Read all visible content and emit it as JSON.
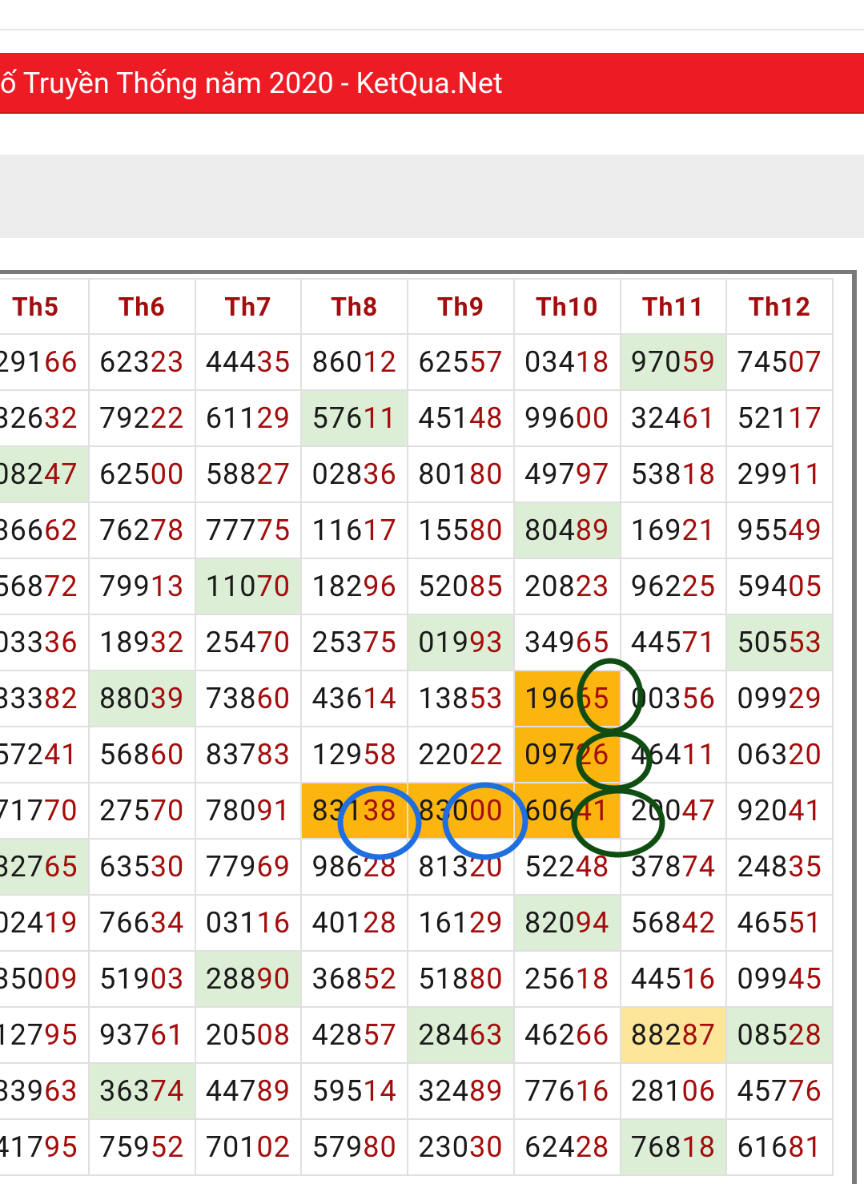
{
  "page": {
    "title": "ố Truyền Thống năm 2020 - KetQua.Net"
  },
  "table": {
    "headers": [
      "Th5",
      "Th6",
      "Th7",
      "Th8",
      "Th9",
      "Th10",
      "Th11",
      "Th12"
    ],
    "rows": [
      [
        {
          "h": "291",
          "t": "66"
        },
        {
          "h": "623",
          "t": "23"
        },
        {
          "h": "444",
          "t": "35"
        },
        {
          "h": "860",
          "t": "12"
        },
        {
          "h": "625",
          "t": "57"
        },
        {
          "h": "034",
          "t": "18"
        },
        {
          "h": "970",
          "t": "59",
          "hl": "green"
        },
        {
          "h": "745",
          "t": "07"
        }
      ],
      [
        {
          "h": "326",
          "t": "32"
        },
        {
          "h": "792",
          "t": "22"
        },
        {
          "h": "611",
          "t": "29"
        },
        {
          "h": "576",
          "t": "11",
          "hl": "green"
        },
        {
          "h": "451",
          "t": "48"
        },
        {
          "h": "996",
          "t": "00"
        },
        {
          "h": "324",
          "t": "61"
        },
        {
          "h": "521",
          "t": "17"
        }
      ],
      [
        {
          "h": "082",
          "t": "47",
          "hl": "green"
        },
        {
          "h": "625",
          "t": "00"
        },
        {
          "h": "588",
          "t": "27"
        },
        {
          "h": "028",
          "t": "36"
        },
        {
          "h": "801",
          "t": "80"
        },
        {
          "h": "497",
          "t": "97"
        },
        {
          "h": "538",
          "t": "18"
        },
        {
          "h": "299",
          "t": "11"
        }
      ],
      [
        {
          "h": "366",
          "t": "62"
        },
        {
          "h": "762",
          "t": "78"
        },
        {
          "h": "777",
          "t": "75"
        },
        {
          "h": "116",
          "t": "17"
        },
        {
          "h": "155",
          "t": "80"
        },
        {
          "h": "804",
          "t": "89",
          "hl": "green"
        },
        {
          "h": "169",
          "t": "21"
        },
        {
          "h": "955",
          "t": "49"
        }
      ],
      [
        {
          "h": "568",
          "t": "72"
        },
        {
          "h": "799",
          "t": "13"
        },
        {
          "h": "110",
          "t": "70",
          "hl": "green"
        },
        {
          "h": "182",
          "t": "96"
        },
        {
          "h": "520",
          "t": "85"
        },
        {
          "h": "208",
          "t": "23"
        },
        {
          "h": "962",
          "t": "25"
        },
        {
          "h": "594",
          "t": "05"
        }
      ],
      [
        {
          "h": "033",
          "t": "36"
        },
        {
          "h": "189",
          "t": "32"
        },
        {
          "h": "254",
          "t": "70"
        },
        {
          "h": "253",
          "t": "75"
        },
        {
          "h": "019",
          "t": "93",
          "hl": "green"
        },
        {
          "h": "349",
          "t": "65"
        },
        {
          "h": "445",
          "t": "71"
        },
        {
          "h": "505",
          "t": "53",
          "hl": "green"
        }
      ],
      [
        {
          "h": "333",
          "t": "82"
        },
        {
          "h": "880",
          "t": "39",
          "hl": "green"
        },
        {
          "h": "738",
          "t": "60"
        },
        {
          "h": "436",
          "t": "14"
        },
        {
          "h": "138",
          "t": "53"
        },
        {
          "h": "196",
          "t": "65",
          "hl": "orange"
        },
        {
          "h": "003",
          "t": "56"
        },
        {
          "h": "099",
          "t": "29"
        }
      ],
      [
        {
          "h": "572",
          "t": "41"
        },
        {
          "h": "568",
          "t": "60"
        },
        {
          "h": "837",
          "t": "83"
        },
        {
          "h": "129",
          "t": "58"
        },
        {
          "h": "220",
          "t": "22"
        },
        {
          "h": "097",
          "t": "26",
          "hl": "orange"
        },
        {
          "h": "464",
          "t": "11"
        },
        {
          "h": "063",
          "t": "20"
        }
      ],
      [
        {
          "h": "717",
          "t": "70"
        },
        {
          "h": "275",
          "t": "70"
        },
        {
          "h": "780",
          "t": "91"
        },
        {
          "h": "831",
          "t": "38",
          "hl": "orange"
        },
        {
          "h": "830",
          "t": "00",
          "hl": "orange"
        },
        {
          "h": "606",
          "t": "41",
          "hl": "orange"
        },
        {
          "h": "200",
          "t": "47"
        },
        {
          "h": "920",
          "t": "41"
        }
      ],
      [
        {
          "h": "327",
          "t": "65",
          "hl": "green"
        },
        {
          "h": "635",
          "t": "30"
        },
        {
          "h": "779",
          "t": "69"
        },
        {
          "h": "986",
          "t": "28"
        },
        {
          "h": "813",
          "t": "20"
        },
        {
          "h": "522",
          "t": "48"
        },
        {
          "h": "378",
          "t": "74"
        },
        {
          "h": "248",
          "t": "35"
        }
      ],
      [
        {
          "h": "024",
          "t": "19"
        },
        {
          "h": "766",
          "t": "34"
        },
        {
          "h": "031",
          "t": "16"
        },
        {
          "h": "401",
          "t": "28"
        },
        {
          "h": "161",
          "t": "29"
        },
        {
          "h": "820",
          "t": "94",
          "hl": "green"
        },
        {
          "h": "568",
          "t": "42"
        },
        {
          "h": "465",
          "t": "51"
        }
      ],
      [
        {
          "h": "350",
          "t": "09"
        },
        {
          "h": "519",
          "t": "03"
        },
        {
          "h": "288",
          "t": "90",
          "hl": "green"
        },
        {
          "h": "368",
          "t": "52"
        },
        {
          "h": "518",
          "t": "80"
        },
        {
          "h": "256",
          "t": "18"
        },
        {
          "h": "445",
          "t": "16"
        },
        {
          "h": "099",
          "t": "45"
        }
      ],
      [
        {
          "h": "127",
          "t": "95"
        },
        {
          "h": "937",
          "t": "61"
        },
        {
          "h": "205",
          "t": "08"
        },
        {
          "h": "428",
          "t": "57"
        },
        {
          "h": "284",
          "t": "63",
          "hl": "green"
        },
        {
          "h": "462",
          "t": "66"
        },
        {
          "h": "882",
          "t": "87",
          "hl": "yellow"
        },
        {
          "h": "085",
          "t": "28",
          "hl": "green"
        }
      ],
      [
        {
          "h": "339",
          "t": "63"
        },
        {
          "h": "363",
          "t": "74",
          "hl": "green"
        },
        {
          "h": "447",
          "t": "89"
        },
        {
          "h": "595",
          "t": "14"
        },
        {
          "h": "324",
          "t": "89"
        },
        {
          "h": "776",
          "t": "16"
        },
        {
          "h": "281",
          "t": "06"
        },
        {
          "h": "457",
          "t": "76"
        }
      ],
      [
        {
          "h": "417",
          "t": "95"
        },
        {
          "h": "759",
          "t": "52"
        },
        {
          "h": "701",
          "t": "02"
        },
        {
          "h": "579",
          "t": "80"
        },
        {
          "h": "230",
          "t": "30"
        },
        {
          "h": "624",
          "t": "28"
        },
        {
          "h": "768",
          "t": "18",
          "hl": "green"
        },
        {
          "h": "616",
          "t": "81"
        }
      ]
    ]
  },
  "annotations": [
    {
      "kind": "ellipse",
      "color": "#1e6fe0",
      "label": "blue-circle"
    },
    {
      "kind": "ellipse",
      "color": "#1e6fe0",
      "label": "blue-circle"
    },
    {
      "kind": "ellipse",
      "color": "#0f4d12",
      "label": "green-circle"
    },
    {
      "kind": "ellipse",
      "color": "#0f4d12",
      "label": "green-circle"
    },
    {
      "kind": "ellipse",
      "color": "#0f4d12",
      "label": "green-circle"
    }
  ]
}
